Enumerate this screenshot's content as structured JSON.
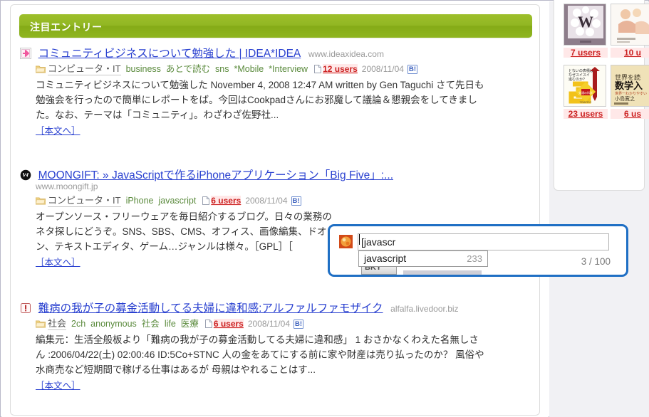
{
  "section": {
    "header_title": "注目エントリー"
  },
  "entries": [
    {
      "favicon": "pink-asterisk-icon",
      "title": "コミュニティビジネスについて勉強した | IDEA*IDEA",
      "domain": "www.ideaxidea.com",
      "domain_below": "",
      "category": "コンピュータ・IT",
      "tags": [
        "business",
        "あとで読む",
        "sns",
        "*Mobile",
        "*Interview"
      ],
      "users": "12 users",
      "date": "2008/11/04",
      "badge": "B!",
      "body": "コミュニティビジネスについて勉強した November 4, 2008 12:47 AM written by Gen Taguchi さて先日も勉強会を行ったので簡単にレポートをば。今回はCookpadさんにお邪魔して議論＆懇親会をしてきました。なお、テーマは「コミュニティ」。わざわざ佐野社...",
      "more": "［本文へ］"
    },
    {
      "favicon": "moongift-circle-m-icon",
      "title": "MOONGIFT: » JavaScriptで作るiPhoneアプリケーション「Big Five」:...",
      "domain": "",
      "domain_below": "www.moongift.jp",
      "category": "コンピュータ・IT",
      "tags": [
        "iPhone",
        "javascript"
      ],
      "users": "6 users",
      "date": "2008/11/04",
      "badge": "B!",
      "body": "オープンソース・フリーウェアを毎日紹介するブログ。日々の業務のネタ探しにどうぞ。SNS、SBS、CMS、オフィス、画像編集、ドオン、テキストエディタ、ゲーム…ジャンルは様々。［GPL］［",
      "more": "［本文へ］"
    },
    {
      "favicon": "red-exclamation-icon",
      "title": "難病の我が子の募金活動してる夫婦に違和感:アルファルファモザイク",
      "domain": "alfalfa.livedoor.biz",
      "domain_below": "",
      "category": "社会",
      "tags": [
        "2ch",
        "anonymous",
        "社会",
        "life",
        "医療"
      ],
      "users": "6 users",
      "date": "2008/11/04",
      "badge": "B!",
      "body": "編集元：生活全般板より「難病の我が子の募金活動してる夫婦に違和感」 1 おさかなくわえた名無しさん :2006/04/22(土) 02:00:46 ID:5Co+STNC 人の金をあてにする前に家や財産は売り払ったのか？ 風俗や水商売など短期間で稼げる仕事はあるが 母親はやれることはす...",
      "more": "［本文へ］"
    }
  ],
  "sidebar": {
    "books": [
      {
        "users": "7 users",
        "cover": "white-W-flower-cover"
      },
      {
        "users": "10 u",
        "cover": "illustration-cover"
      },
      {
        "users": "23 users",
        "cover": "yellow-arrow-maze-cover"
      },
      {
        "users": "6 us",
        "cover": "math-intro-cover"
      }
    ]
  },
  "tag_popup": {
    "input_value": "[javascr",
    "suggestions": [
      {
        "label": "javascript",
        "count": "233"
      }
    ],
    "counter": "3 / 100",
    "hidden_button_label": "BKY",
    "accent_color": "#1f6fc4"
  }
}
